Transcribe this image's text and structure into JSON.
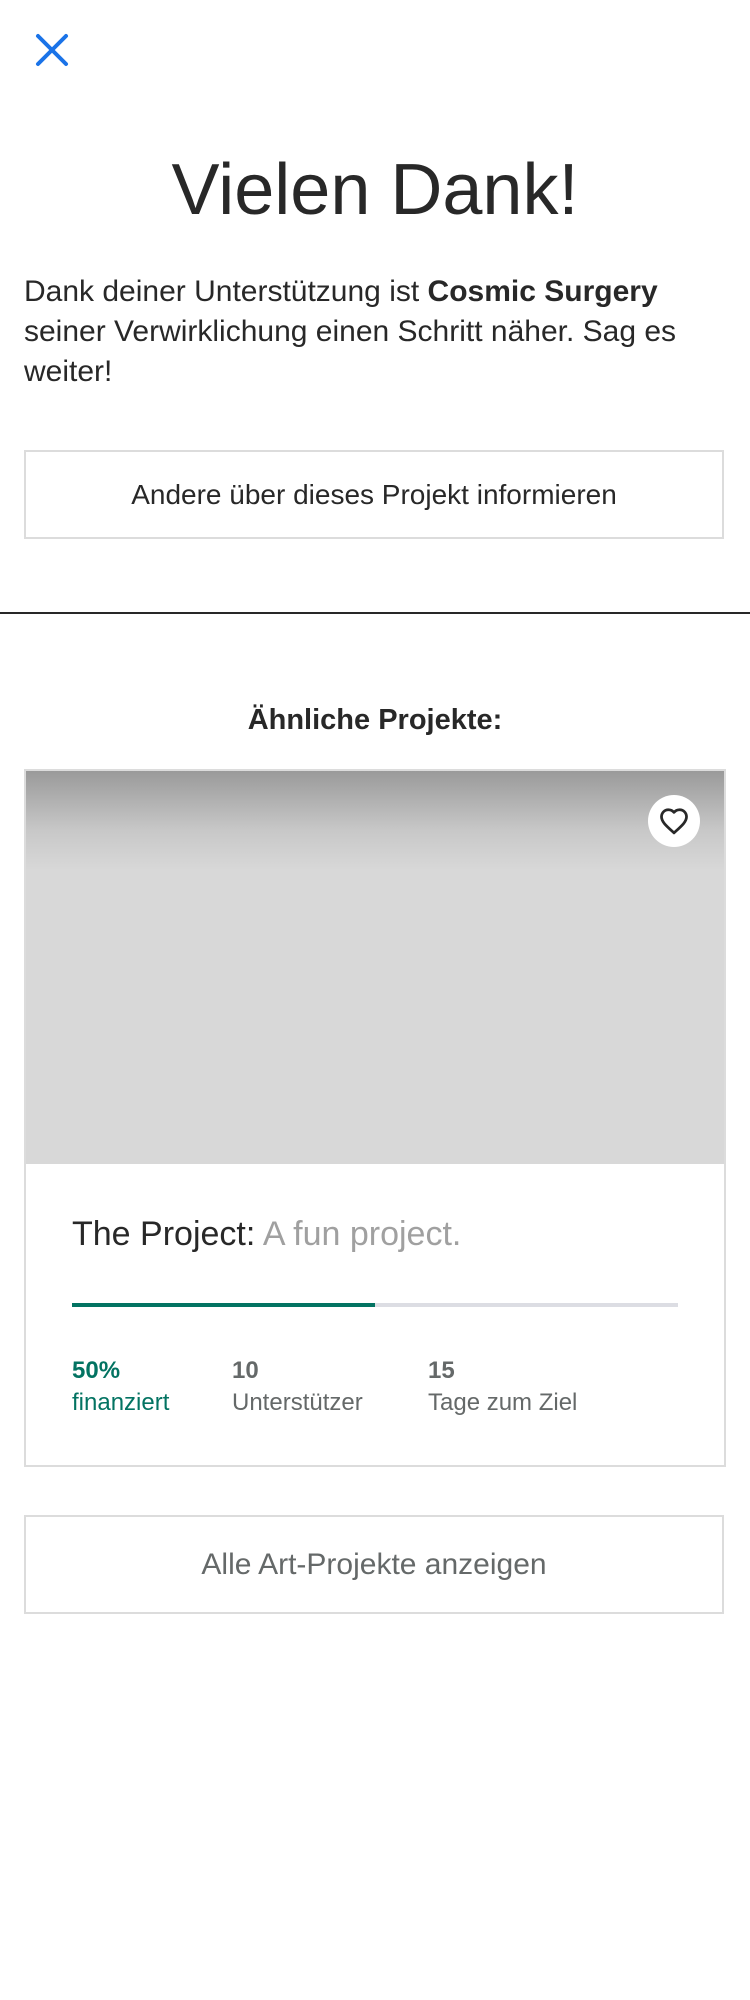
{
  "header": {
    "close_icon": "close-icon",
    "accent_color": "#1a73e8"
  },
  "thanks": {
    "title": "Vielen Dank!",
    "message_prefix": "Dank deiner Unterstützung ist ",
    "project_name": "Cosmic Surgery",
    "message_suffix": " seiner Verwirklichung einen Schritt näher. Sag es weiter!",
    "share_label": "Andere über dieses Projekt informieren"
  },
  "similar": {
    "title": "Ähnliche Projekte:",
    "card": {
      "name": "The Project:",
      "blurb": " A fun project.",
      "favorite_icon": "heart-icon",
      "progress": 0.5,
      "progress_color": "#037362",
      "stats": {
        "funded_value": "50%",
        "funded_label": "finanziert",
        "backers_value": "10",
        "backers_label": "Unterstützer",
        "days_value": "15",
        "days_label": "Tage zum Ziel"
      }
    },
    "all_label": "Alle Art-Projekte anzeigen"
  }
}
